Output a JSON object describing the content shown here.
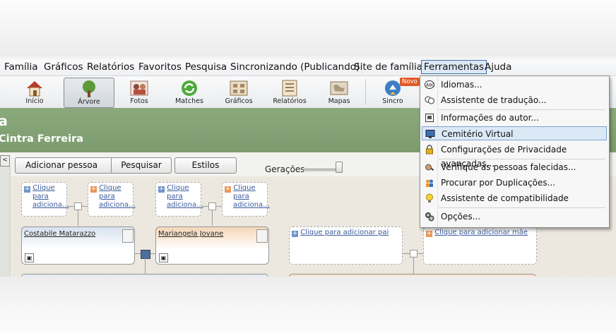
{
  "menubar": {
    "items": [
      "Família",
      "Gráficos",
      "Relatórios",
      "Favoritos",
      "Pesquisa",
      "Sincronizando (Publicando)",
      "Site de família",
      "Ferramentas",
      "Ajuda"
    ]
  },
  "toolbar": {
    "items": [
      "Início",
      "Árvore",
      "Fotos",
      "Matches",
      "Gráficos",
      "Relatórios",
      "Mapas",
      "Sincro"
    ],
    "badge": "Novo"
  },
  "header": {
    "title": "a",
    "subtitle": "Cintra Ferreira"
  },
  "controls": {
    "add_person": "Adicionar pessoa",
    "search": "Pesquisar",
    "styles": "Estilos",
    "generations": "Gerações"
  },
  "tree": {
    "placeholder_short": [
      "Clique",
      "para",
      "adiciona..."
    ],
    "add_father": "Clique para adicionar pai",
    "add_mother": "Clique para adicionar mãe",
    "father_name": "Costabile Matarazzo",
    "mother_name": "Mariangela Jovane"
  },
  "tools_menu": {
    "items": [
      {
        "label": "Idiomas...",
        "icon": "abc-icon"
      },
      {
        "label": "Assistente de tradução...",
        "icon": "speech-bubbles-icon"
      },
      {
        "label": "Informações do autor...",
        "icon": "id-card-icon"
      },
      {
        "label": "Cemitério Virtual",
        "icon": "monitor-icon"
      },
      {
        "label": "Configurações de Privacidade avançadas...",
        "icon": "lock-icon"
      },
      {
        "label": "Verifique as pessoas falecidas...",
        "icon": "magnifier-person-icon"
      },
      {
        "label": "Procurar por Duplicações...",
        "icon": "duplicate-people-icon"
      },
      {
        "label": "Assistente de compatibilidade",
        "icon": "lightbulb-icon"
      },
      {
        "label": "Opções...",
        "icon": "gears-icon"
      }
    ]
  }
}
